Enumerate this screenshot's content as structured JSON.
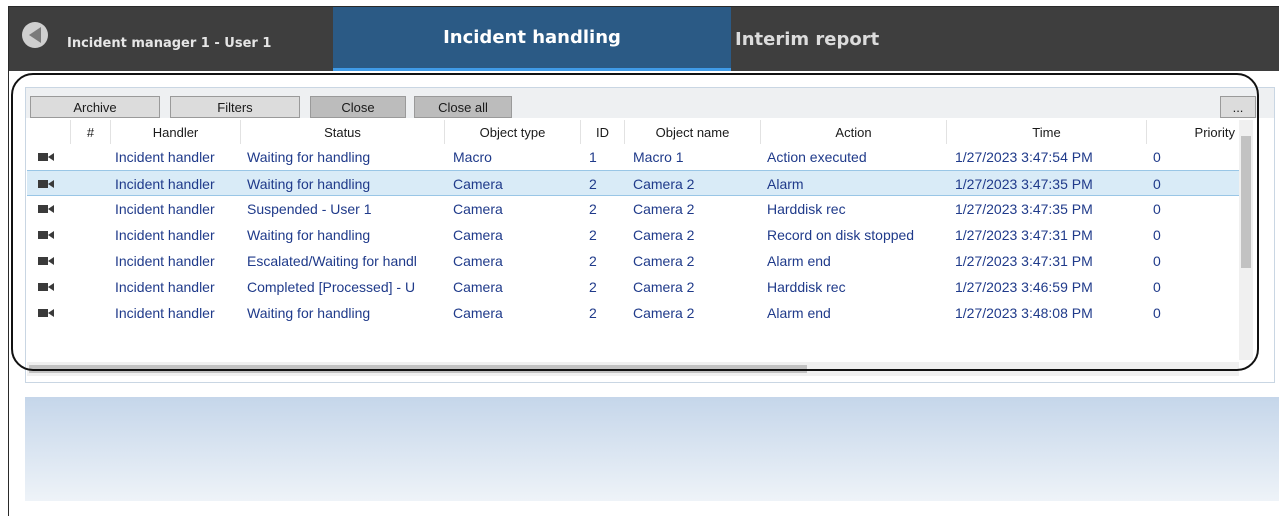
{
  "header": {
    "app_title": "Incident manager 1 - User 1",
    "tabs": [
      {
        "label": "Incident handling",
        "active": true
      },
      {
        "label": "Interim report",
        "active": false
      }
    ]
  },
  "toolbar": {
    "archive_label": "Archive",
    "filters_label": "Filters",
    "close_label": "Close",
    "close_all_label": "Close all",
    "more_label": "..."
  },
  "table": {
    "columns": [
      "",
      "#",
      "Handler",
      "Status",
      "Object type",
      "ID",
      "Object name",
      "Action",
      "Time",
      "Priority"
    ],
    "rows": [
      {
        "icon": "camera-icon",
        "num": "",
        "handler": "Incident handler",
        "status": "Waiting for handling",
        "object_type": "Macro",
        "id": "1",
        "object_name": "Macro 1",
        "action": "Action executed",
        "time": "1/27/2023 3:47:54 PM",
        "priority": "0"
      },
      {
        "icon": "camera-icon",
        "num": "",
        "handler": "Incident handler",
        "status": "Waiting for handling",
        "object_type": "Camera",
        "id": "2",
        "object_name": "Camera 2",
        "action": "Alarm",
        "time": "1/27/2023 3:47:35 PM",
        "priority": "0"
      },
      {
        "icon": "camera-icon",
        "num": "",
        "handler": "Incident handler",
        "status": "Suspended - User 1",
        "object_type": "Camera",
        "id": "2",
        "object_name": "Camera 2",
        "action": "Harddisk rec",
        "time": "1/27/2023 3:47:35 PM",
        "priority": "0"
      },
      {
        "icon": "camera-icon",
        "num": "",
        "handler": "Incident handler",
        "status": "Waiting for handling",
        "object_type": "Camera",
        "id": "2",
        "object_name": "Camera 2",
        "action": "Record on disk stopped",
        "time": "1/27/2023 3:47:31 PM",
        "priority": "0"
      },
      {
        "icon": "camera-icon",
        "num": "",
        "handler": "Incident handler",
        "status": "Escalated/Waiting for handl",
        "object_type": "Camera",
        "id": "2",
        "object_name": "Camera 2",
        "action": "Alarm end",
        "time": "1/27/2023 3:47:31 PM",
        "priority": "0"
      },
      {
        "icon": "camera-icon",
        "num": "",
        "handler": "Incident handler",
        "status": "Completed [Processed] - U",
        "object_type": "Camera",
        "id": "2",
        "object_name": "Camera 2",
        "action": "Harddisk rec",
        "time": "1/27/2023 3:46:59 PM",
        "priority": "0"
      },
      {
        "icon": "camera-icon",
        "num": "",
        "handler": "Incident handler",
        "status": "Waiting for handling",
        "object_type": "Camera",
        "id": "2",
        "object_name": "Camera 2",
        "action": "Alarm end",
        "time": "1/27/2023 3:48:08 PM",
        "priority": "0"
      }
    ],
    "selected_row": 1
  },
  "colors": {
    "topbar": "#3e3e3e",
    "active_tab": "#2b5a85",
    "cell_text": "#1f3a8a",
    "selection": "#d9ebf7"
  }
}
